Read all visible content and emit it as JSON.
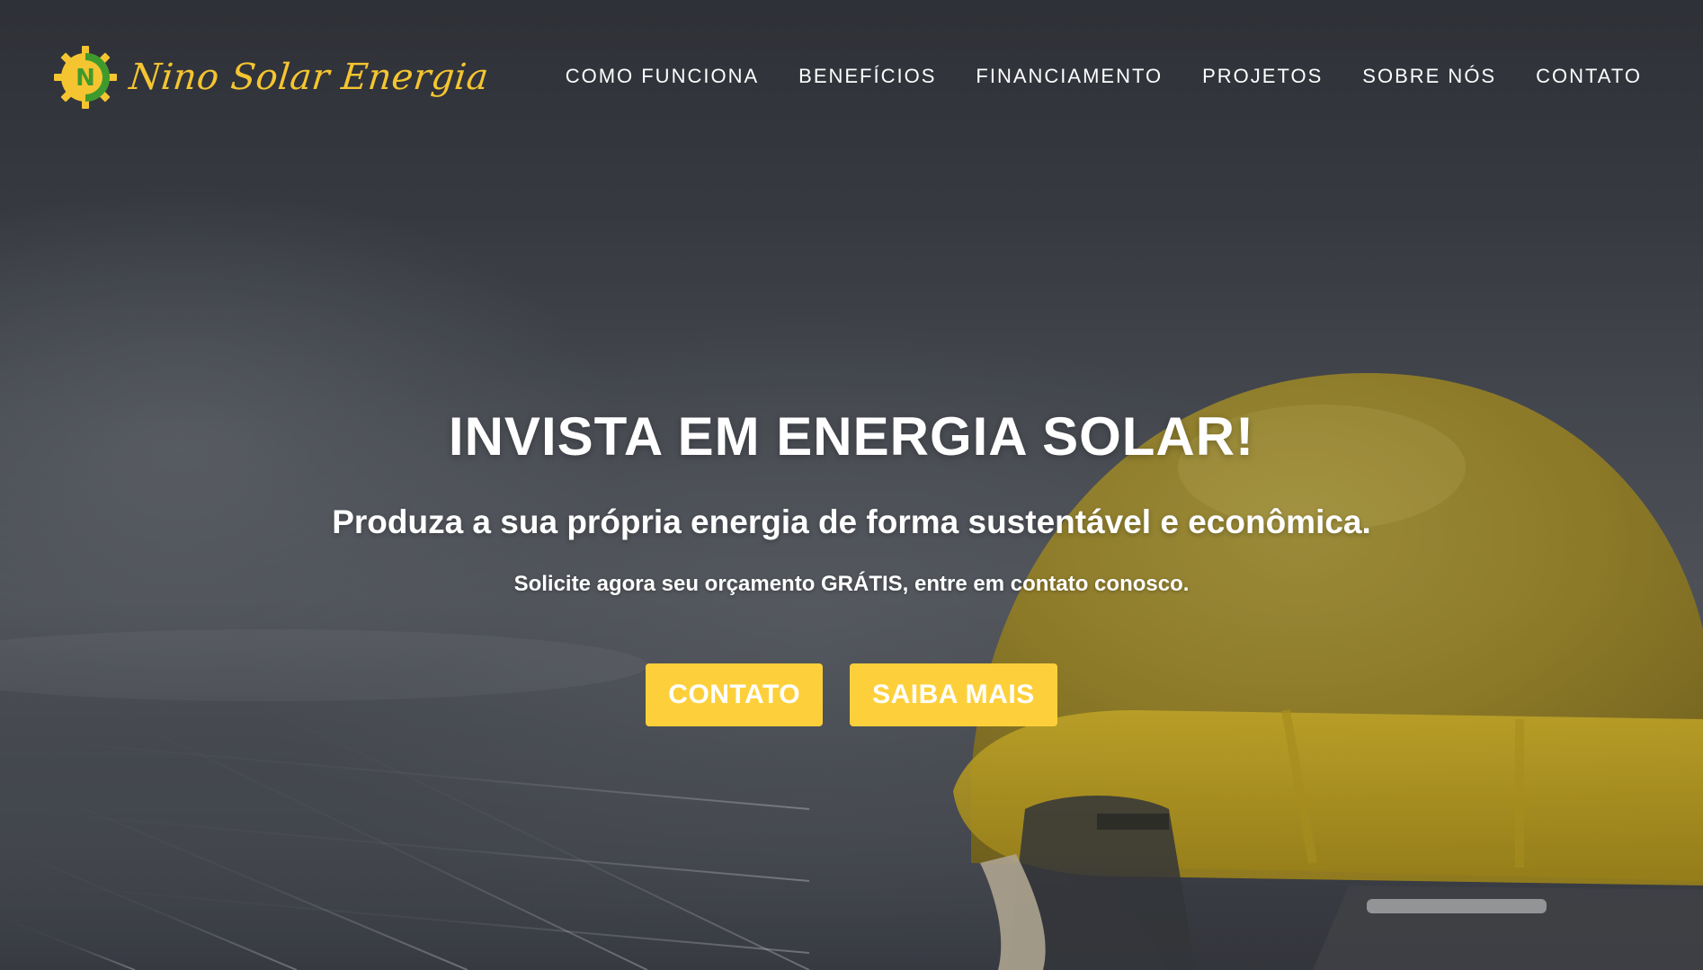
{
  "brand": {
    "name": "Nino Solar Energia",
    "mark_letter": "N",
    "colors": {
      "yellow": "#f5c531",
      "green": "#3f9a2e",
      "button": "#fdd03b"
    }
  },
  "nav": {
    "items": [
      {
        "label": "COMO FUNCIONA"
      },
      {
        "label": "BENEFÍCIOS"
      },
      {
        "label": "FINANCIAMENTO"
      },
      {
        "label": "PROJETOS"
      },
      {
        "label": "SOBRE NÓS"
      },
      {
        "label": "CONTATO"
      }
    ]
  },
  "hero": {
    "title": "INVISTA EM ENERGIA SOLAR!",
    "subtitle": "Produza a sua própria energia de forma sustentável e econômica.",
    "cta_text": "Solicite agora seu orçamento GRÁTIS, entre em contato conosco.",
    "buttons": {
      "contact_label": "CONTATO",
      "more_label": "SAIBA MAIS"
    },
    "background": "solar panels with yellow hard hat"
  }
}
